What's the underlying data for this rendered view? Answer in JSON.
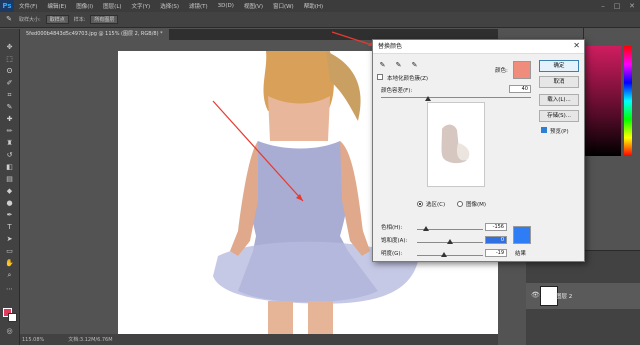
{
  "app": {
    "logo": "Ps"
  },
  "menu": [
    "文件(F)",
    "编辑(E)",
    "图像(I)",
    "图层(L)",
    "文字(Y)",
    "选择(S)",
    "滤镜(T)",
    "3D(D)",
    "视图(V)",
    "窗口(W)",
    "帮助(H)"
  ],
  "options": {
    "sample_size_label": "取样大小:",
    "sample_size_value": "取样点",
    "sample_label": "样本:",
    "sample_value": "所有图层"
  },
  "document": {
    "tab_label": "5fed000b4843d5c49703.jpg @ 115% (图层 2, RGB/8) *",
    "zoom": "115.08%",
    "doc_info": "文档:3.12M/6.76M"
  },
  "dialog": {
    "title": "替换颜色",
    "localized_clusters_label": "本地化颜色簇(Z)",
    "color_label": "颜色:",
    "fuzziness_label": "颜色容差(F):",
    "fuzziness_value": "40",
    "selection_label": "选区(C)",
    "image_label": "图像(M)",
    "hue_label": "色相(H):",
    "hue_value": "-156",
    "saturation_label": "饱和度(A):",
    "saturation_value": "0",
    "lightness_label": "明度(G):",
    "lightness_value": "-19",
    "result_label": "结果",
    "preview_label": "预览(P)",
    "buttons": [
      "确定",
      "取消",
      "载入(L)...",
      "存储(S)..."
    ],
    "sample_color": "#f08c7c",
    "result_color": "#2f7df5"
  },
  "layers": {
    "layer_name": "图层 2"
  },
  "colors": {
    "accent": "#31a8ff",
    "foreground": "#e23b5e",
    "background": "#ffffff"
  }
}
